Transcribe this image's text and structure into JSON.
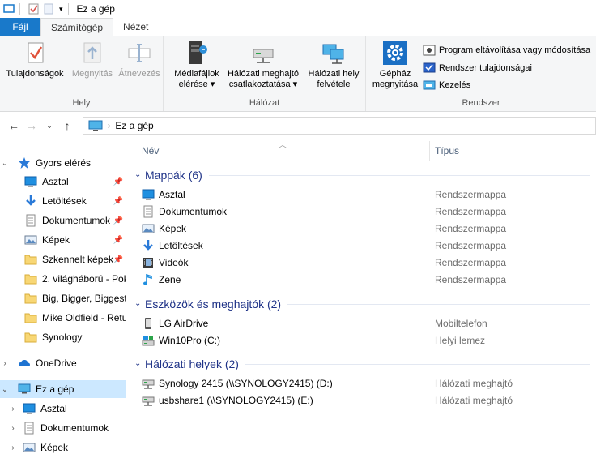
{
  "window": {
    "title": "Ez a gép"
  },
  "tabs": {
    "file": "Fájl",
    "computer": "Számítógép",
    "view": "Nézet"
  },
  "ribbon": {
    "groups": {
      "location": "Hely",
      "network": "Hálózat",
      "system": "Rendszer"
    },
    "buttons": {
      "properties": "Tulajdonságok",
      "open": "Megnyitás",
      "rename": "Átnevezés",
      "media": [
        "Médiafájlok",
        "elérése ▾"
      ],
      "map_drive": [
        "Hálózati meghajtó",
        "csatlakoztatása ▾"
      ],
      "add_location": [
        "Hálózati hely",
        "felvétele"
      ],
      "settings": [
        "Gépház",
        "megnyitása"
      ],
      "uninstall": "Program eltávolítása vagy módosítása",
      "sys_props": "Rendszer tulajdonságai",
      "manage": "Kezelés"
    }
  },
  "address": {
    "path": "Ez a gép"
  },
  "nav": {
    "quick_access": "Gyors elérés",
    "items": [
      {
        "label": "Asztal",
        "pinned": true
      },
      {
        "label": "Letöltések",
        "pinned": true
      },
      {
        "label": "Dokumentumok",
        "pinned": true
      },
      {
        "label": "Képek",
        "pinned": true
      },
      {
        "label": "Szkennelt képek",
        "pinned": true
      },
      {
        "label": "2. világháború - Pok"
      },
      {
        "label": "Big, Bigger, Biggest"
      },
      {
        "label": "Mike Oldfield - Retu"
      },
      {
        "label": "Synology"
      }
    ],
    "onedrive": "OneDrive",
    "this_pc": "Ez a gép",
    "pc_children": [
      "Asztal",
      "Dokumentumok",
      "Képek"
    ]
  },
  "columns": {
    "name": "Név",
    "type": "Típus"
  },
  "sections": {
    "folders": {
      "title": "Mappák (6)",
      "rows": [
        {
          "name": "Asztal",
          "type": "Rendszermappa"
        },
        {
          "name": "Dokumentumok",
          "type": "Rendszermappa"
        },
        {
          "name": "Képek",
          "type": "Rendszermappa"
        },
        {
          "name": "Letöltések",
          "type": "Rendszermappa"
        },
        {
          "name": "Videók",
          "type": "Rendszermappa"
        },
        {
          "name": "Zene",
          "type": "Rendszermappa"
        }
      ]
    },
    "devices": {
      "title": "Eszközök és meghajtók (2)",
      "rows": [
        {
          "name": "LG AirDrive",
          "type": "Mobiltelefon"
        },
        {
          "name": "Win10Pro (C:)",
          "type": "Helyi lemez"
        }
      ]
    },
    "network": {
      "title": "Hálózati helyek (2)",
      "rows": [
        {
          "name": "Synology 2415 (\\\\SYNOLOGY2415) (D:)",
          "type": "Hálózati meghajtó"
        },
        {
          "name": "usbshare1 (\\\\SYNOLOGY2415) (E:)",
          "type": "Hálózati meghajtó"
        }
      ]
    }
  }
}
